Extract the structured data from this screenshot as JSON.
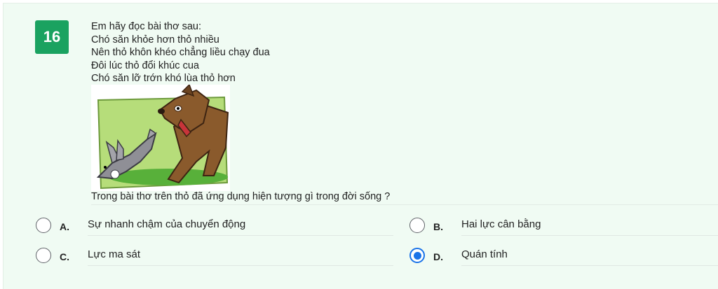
{
  "question": {
    "number": "16",
    "stem_lines": [
      "Em hãy đọc bài thơ sau:",
      "Chó săn khỏe hơn thỏ nhiều",
      "Nên thỏ khôn khéo chẳng liều chạy đua",
      "Đôi lúc thỏ đổi khúc cua",
      "Chó săn lỡ trớn khó lùa thỏ hơn"
    ],
    "picture_subject": "dog-chasing-rabbit",
    "prompt": "Trong bài thơ trên thỏ đã ứng dụng hiện tượng gì trong đời sống ?"
  },
  "options": [
    {
      "letter": "A.",
      "text": "Sự nhanh chậm của chuyển động",
      "selected": false
    },
    {
      "letter": "B.",
      "text": "Hai lực cân bằng",
      "selected": false
    },
    {
      "letter": "C.",
      "text": "Lực ma sát",
      "selected": false
    },
    {
      "letter": "D.",
      "text": "Quán tính",
      "selected": true
    }
  ],
  "colors": {
    "number_badge": "#1aa260",
    "card_background": "#f0fbf3",
    "radio_selected": "#1a73e8"
  }
}
